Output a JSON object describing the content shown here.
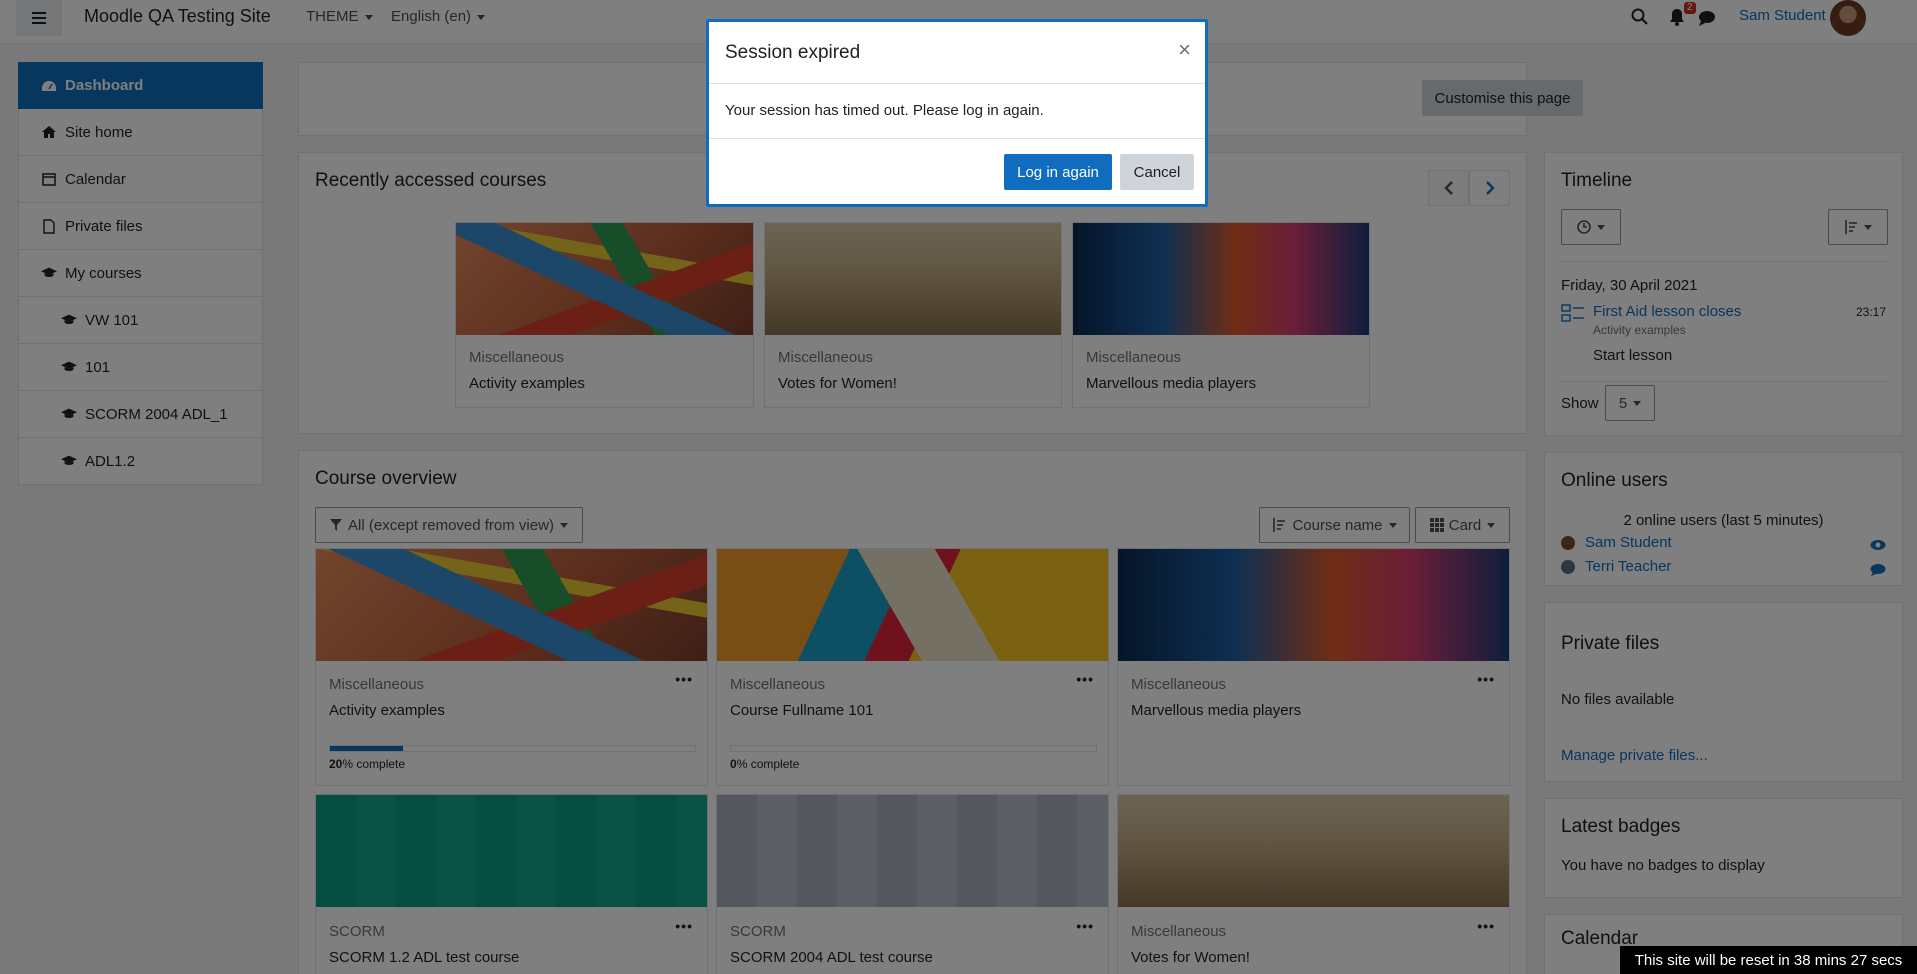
{
  "navbar": {
    "site_name": "Moodle QA Testing Site",
    "theme_menu": "THEME",
    "language_menu": "English (en)",
    "notification_count": "2",
    "user_name": "Sam Student"
  },
  "drawer": {
    "items": [
      {
        "label": "Dashboard",
        "icon": "dashboard-icon"
      },
      {
        "label": "Site home",
        "icon": "home-icon"
      },
      {
        "label": "Calendar",
        "icon": "calendar-icon"
      },
      {
        "label": "Private files",
        "icon": "file-icon"
      },
      {
        "label": "My courses",
        "icon": "graduation-cap-icon"
      },
      {
        "label": "VW 101",
        "icon": "graduation-cap-icon"
      },
      {
        "label": "101",
        "icon": "graduation-cap-icon"
      },
      {
        "label": "SCORM 2004 ADL_1",
        "icon": "graduation-cap-icon"
      },
      {
        "label": "ADL1.2",
        "icon": "graduation-cap-icon"
      }
    ]
  },
  "customise_button": "Customise this page",
  "recent": {
    "title": "Recently accessed courses",
    "courses": [
      {
        "category": "Miscellaneous",
        "name": "Activity examples"
      },
      {
        "category": "Miscellaneous",
        "name": "Votes for Women!"
      },
      {
        "category": "Miscellaneous",
        "name": "Marvellous media players"
      }
    ]
  },
  "overview": {
    "title": "Course overview",
    "filter": "All (except removed from view)",
    "sort": "Course name",
    "view": "Card",
    "courses": [
      {
        "category": "Miscellaneous",
        "name": "Activity examples",
        "progress_value": "20",
        "progress_suffix": "% complete",
        "progress": 0.2
      },
      {
        "category": "Miscellaneous",
        "name": "Course Fullname 101",
        "progress_value": "0",
        "progress_suffix": "% complete",
        "progress": 0
      },
      {
        "category": "Miscellaneous",
        "name": "Marvellous media players"
      },
      {
        "category": "SCORM",
        "name": "SCORM 1.2 ADL test course"
      },
      {
        "category": "SCORM",
        "name": "SCORM 2004 ADL test course"
      },
      {
        "category": "Miscellaneous",
        "name": "Votes for Women!"
      }
    ]
  },
  "timeline": {
    "title": "Timeline",
    "date": "Friday, 30 April 2021",
    "event_name": "First Aid lesson closes",
    "event_course": "Activity examples",
    "event_time": "23:17",
    "event_action": "Start lesson",
    "show_label": "Show",
    "show_value": "5"
  },
  "online_users": {
    "title": "Online users",
    "summary": "2 online users (last 5 minutes)",
    "users": [
      "Sam Student",
      "Terri Teacher"
    ]
  },
  "private_files": {
    "title": "Private files",
    "empty": "No files available",
    "manage_link": "Manage private files..."
  },
  "badges": {
    "title": "Latest badges",
    "empty": "You have no badges to display"
  },
  "calendar": {
    "title": "Calendar"
  },
  "modal": {
    "title": "Session expired",
    "close": "×",
    "body": "Your session has timed out. Please log in again.",
    "login_button": "Log in again",
    "cancel_button": "Cancel"
  },
  "reset_notice": "This site will be reset in 38 mins 27 secs",
  "colors": {
    "primary": "#0f6cbf",
    "secondary": "#ced4da",
    "overlay": "rgba(0,0,0,0.5)"
  }
}
